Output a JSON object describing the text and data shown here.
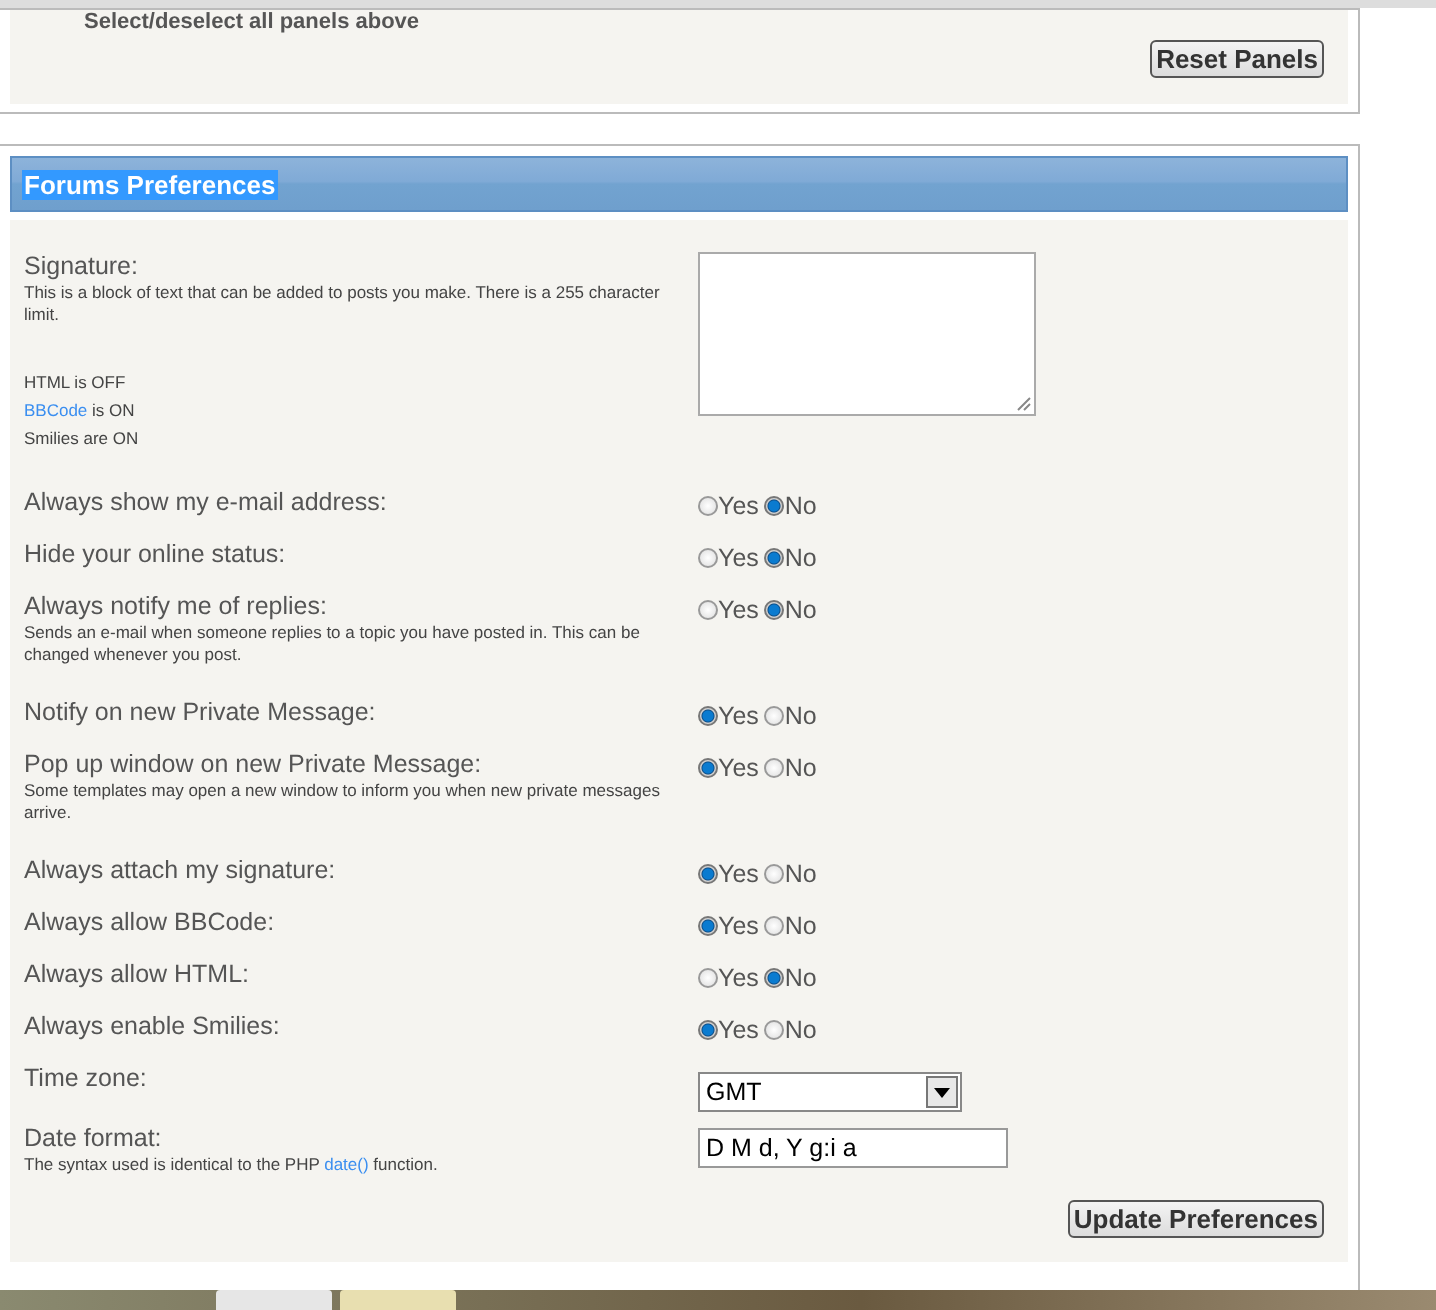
{
  "top_panel": {
    "cut_text": "Select/deselect all panels above",
    "button": "Reset Panels"
  },
  "preferences": {
    "title": "Forums Preferences",
    "title_selected": true,
    "rows": [
      {
        "kind": "textarea",
        "label": "Signature:",
        "description": "This is a block of text that can be added to posts you make. There is a 255 character limit.",
        "notes": [
          {
            "text": "HTML is OFF"
          },
          {
            "link": "BBCode",
            "text": " is ON"
          },
          {
            "text": "Smilies are ON"
          }
        ]
      },
      {
        "kind": "radio",
        "label": "Always show my e-mail address:",
        "options": [
          {
            "label": "Yes",
            "selected": false
          },
          {
            "label": "No",
            "selected": true
          }
        ]
      },
      {
        "kind": "radio",
        "label": "Hide your online status:",
        "options": [
          {
            "label": "Yes",
            "selected": false
          },
          {
            "label": "No",
            "selected": true
          }
        ]
      },
      {
        "kind": "radio",
        "label": "Always notify me of replies:",
        "description": "Sends an e-mail when someone replies to a topic you have posted in. This can be changed whenever you post.",
        "options": [
          {
            "label": "Yes",
            "selected": false
          },
          {
            "label": "No",
            "selected": true
          }
        ]
      },
      {
        "kind": "radio",
        "label": "Notify on new Private Message:",
        "options": [
          {
            "label": "Yes",
            "selected": true
          },
          {
            "label": "No",
            "selected": false
          }
        ]
      },
      {
        "kind": "radio",
        "label": "Pop up window on new Private Message:",
        "description": "Some templates may open a new window to inform you when new private messages arrive.",
        "options": [
          {
            "label": "Yes",
            "selected": true
          },
          {
            "label": "No",
            "selected": false
          }
        ]
      },
      {
        "kind": "radio",
        "label": "Always attach my signature:",
        "options": [
          {
            "label": "Yes",
            "selected": true
          },
          {
            "label": "No",
            "selected": false
          }
        ]
      },
      {
        "kind": "radio",
        "label": "Always allow BBCode:",
        "options": [
          {
            "label": "Yes",
            "selected": true
          },
          {
            "label": "No",
            "selected": false
          }
        ]
      },
      {
        "kind": "radio",
        "label": "Always allow HTML:",
        "options": [
          {
            "label": "Yes",
            "selected": false
          },
          {
            "label": "No",
            "selected": true
          }
        ]
      },
      {
        "kind": "radio",
        "label": "Always enable Smilies:",
        "options": [
          {
            "label": "Yes",
            "selected": true
          },
          {
            "label": "No",
            "selected": false
          }
        ]
      },
      {
        "kind": "select",
        "label": "Time zone:",
        "value": "GMT"
      },
      {
        "kind": "text",
        "label": "Date format:",
        "value": "D M d, Y g:i a",
        "desc_before": "The syntax used is identical to the PHP ",
        "desc_link": "date()",
        "desc_after": " function."
      }
    ],
    "button": "Update Preferences"
  }
}
